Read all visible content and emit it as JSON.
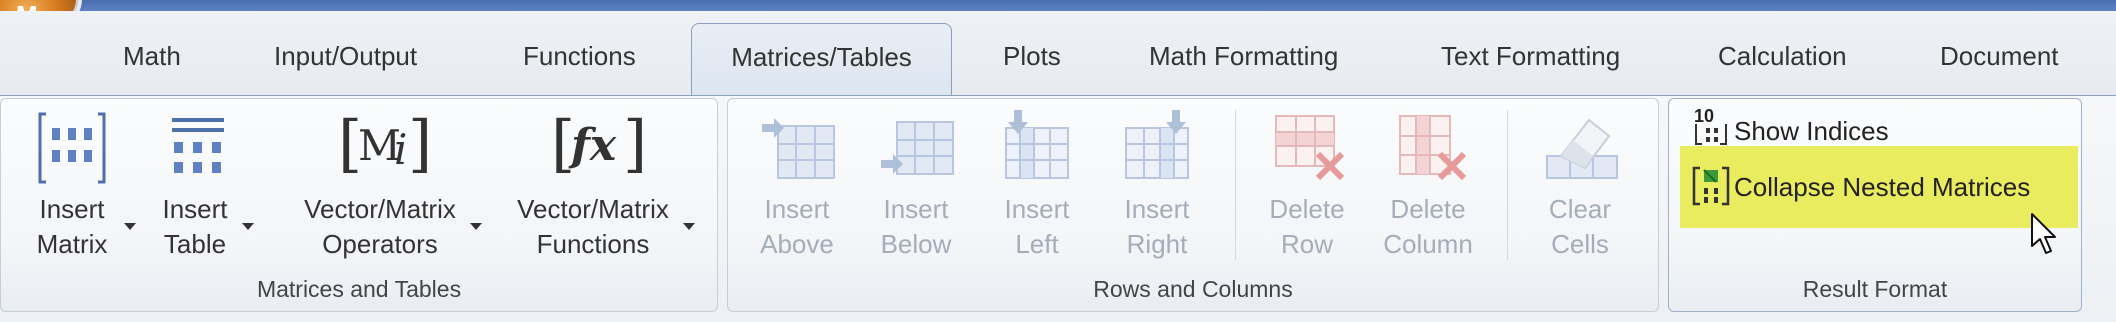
{
  "app": {
    "orb_letter": "M"
  },
  "tabs": [
    {
      "label": "Math"
    },
    {
      "label": "Input/Output"
    },
    {
      "label": "Functions"
    },
    {
      "label": "Matrices/Tables",
      "active": true
    },
    {
      "label": "Plots"
    },
    {
      "label": "Math Formatting"
    },
    {
      "label": "Text Formatting"
    },
    {
      "label": "Calculation"
    },
    {
      "label": "Document"
    }
  ],
  "groups": {
    "matrices_tables": {
      "label": "Matrices and Tables",
      "buttons": [
        {
          "line1": "Insert",
          "line2": "Matrix",
          "icon": "matrix-icon"
        },
        {
          "line1": "Insert",
          "line2": "Table",
          "icon": "table-icon"
        },
        {
          "line1": "Vector/Matrix",
          "line2": "Operators",
          "icon": "operators-icon",
          "glyph": "M",
          "glyph_sub": "i"
        },
        {
          "line1": "Vector/Matrix",
          "line2": "Functions",
          "icon": "functions-icon",
          "glyph": "fx"
        }
      ]
    },
    "rows_columns": {
      "label": "Rows and Columns",
      "buttons": [
        {
          "line1": "Insert",
          "line2": "Above",
          "icon": "insert-above-icon"
        },
        {
          "line1": "Insert",
          "line2": "Below",
          "icon": "insert-below-icon"
        },
        {
          "line1": "Insert",
          "line2": "Left",
          "icon": "insert-left-icon"
        },
        {
          "line1": "Insert",
          "line2": "Right",
          "icon": "insert-right-icon"
        },
        {
          "line1": "Delete",
          "line2": "Row",
          "icon": "delete-row-icon"
        },
        {
          "line1": "Delete",
          "line2": "Column",
          "icon": "delete-column-icon"
        },
        {
          "line1": "Clear",
          "line2": "Cells",
          "icon": "clear-cells-icon"
        }
      ]
    },
    "result_format": {
      "label": "Result Format",
      "show_indices": {
        "label": "Show Indices",
        "icon_text": "10"
      },
      "collapse_nested": {
        "label": "Collapse Nested Matrices"
      }
    }
  },
  "colors": {
    "accent": "#5d81c2",
    "highlight": "#e9ec5e",
    "disabled_text": "#a5adb8",
    "icon_blue": "#4f6fa8"
  }
}
